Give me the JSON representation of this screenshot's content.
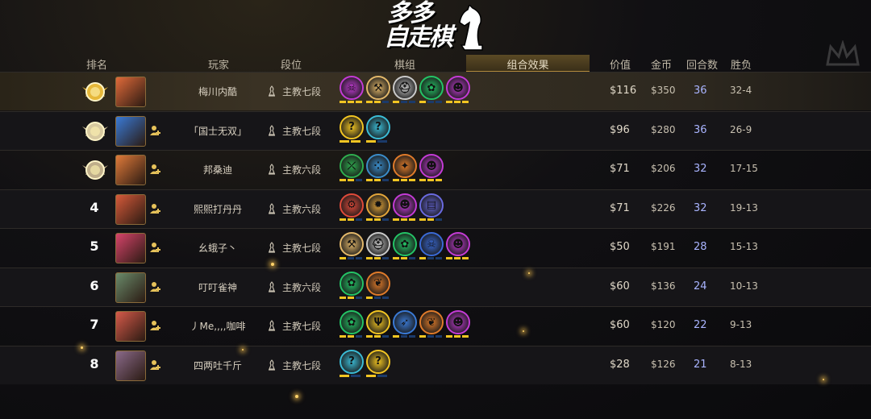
{
  "logo": {
    "line1": "多多",
    "line2": "自走棋"
  },
  "header": {
    "rank": "排名",
    "player": "玩家",
    "tier": "段位",
    "pieces": "棋组",
    "combo": "组合效果",
    "value": "价值",
    "gold": "金币",
    "rounds": "回合数",
    "record": "胜负"
  },
  "colors": {
    "gold": "#f2c522",
    "bar_empty": "#1b3a6a",
    "rounds_text": "#a9b4ff"
  },
  "players": [
    {
      "rank": "1",
      "rank_display": "gold-medal-icon",
      "name": "梅川内酷",
      "tier": "主教七段",
      "synergies": [
        {
          "icon": "demon-skull-icon",
          "color": "#c43bd6",
          "filled": 3,
          "total": 3
        },
        {
          "icon": "axe-icon",
          "color": "#e3b86a",
          "filled": 2,
          "total": 3
        },
        {
          "icon": "helmet-icon",
          "color": "#c9c9c9",
          "filled": 1,
          "total": 3
        },
        {
          "icon": "paw-icon",
          "color": "#24c466",
          "filled": 1,
          "total": 3
        },
        {
          "icon": "imp-icon",
          "color": "#c43bd6",
          "filled": 3,
          "total": 3
        }
      ],
      "value": "$116",
      "gold": "$350",
      "rounds": "36",
      "record": "32-4"
    },
    {
      "rank": "2",
      "rank_display": "silver-medal-icon",
      "name": "「国士无双」",
      "tier": "主教七段",
      "synergies": [
        {
          "icon": "question-mark-icon",
          "color": "#f2c522",
          "filled": 2,
          "total": 2
        },
        {
          "icon": "question-mark-icon",
          "color": "#3bbcd6",
          "filled": 1,
          "total": 2
        }
      ],
      "value": "$96",
      "gold": "$280",
      "rounds": "36",
      "record": "26-9"
    },
    {
      "rank": "3",
      "rank_display": "bronze-medal-icon",
      "name": "邦桑迪",
      "tier": "主教六段",
      "synergies": [
        {
          "icon": "bow-icon",
          "color": "#2fae4f",
          "filled": 2,
          "total": 3
        },
        {
          "icon": "dots-icon",
          "color": "#3a8cc9",
          "filled": 2,
          "total": 3
        },
        {
          "icon": "fox-icon",
          "color": "#e07b2a",
          "filled": 3,
          "total": 3
        },
        {
          "icon": "imp-icon",
          "color": "#c43bd6",
          "filled": 3,
          "total": 3
        }
      ],
      "value": "$71",
      "gold": "$206",
      "rounds": "32",
      "record": "17-15"
    },
    {
      "rank": "4",
      "rank_display": "4",
      "name": "熙熙打丹丹",
      "tier": "主教六段",
      "synergies": [
        {
          "icon": "mech-icon",
          "color": "#e04a3a",
          "filled": 2,
          "total": 3
        },
        {
          "icon": "gear-icon",
          "color": "#e3a53a",
          "filled": 2,
          "total": 3
        },
        {
          "icon": "imp-icon",
          "color": "#c43bd6",
          "filled": 3,
          "total": 3
        },
        {
          "icon": "book-icon",
          "color": "#6a6ae0",
          "filled": 2,
          "total": 3
        }
      ],
      "value": "$71",
      "gold": "$226",
      "rounds": "32",
      "record": "19-13"
    },
    {
      "rank": "5",
      "rank_display": "5",
      "name": "幺蛾子丶",
      "tier": "主教七段",
      "synergies": [
        {
          "icon": "axe-icon",
          "color": "#e3b86a",
          "filled": 1,
          "total": 3
        },
        {
          "icon": "helmet-icon",
          "color": "#c9c9c9",
          "filled": 2,
          "total": 3
        },
        {
          "icon": "paw-icon",
          "color": "#24c466",
          "filled": 2,
          "total": 3
        },
        {
          "icon": "demon-skull-icon",
          "color": "#3a6ad6",
          "filled": 1,
          "total": 3
        },
        {
          "icon": "imp-icon",
          "color": "#c43bd6",
          "filled": 3,
          "total": 3
        }
      ],
      "value": "$50",
      "gold": "$191",
      "rounds": "28",
      "record": "15-13"
    },
    {
      "rank": "6",
      "rank_display": "6",
      "name": "叮叮雀神",
      "tier": "主教六段",
      "synergies": [
        {
          "icon": "paw-icon",
          "color": "#24c466",
          "filled": 2,
          "total": 3
        },
        {
          "icon": "leaf-icon",
          "color": "#e07b2a",
          "filled": 1,
          "total": 3
        }
      ],
      "value": "$60",
      "gold": "$136",
      "rounds": "24",
      "record": "10-13"
    },
    {
      "rank": "7",
      "rank_display": "7",
      "name": "丿Me,,,,咖啡",
      "tier": "主教七段",
      "synergies": [
        {
          "icon": "paw-icon",
          "color": "#24c466",
          "filled": 2,
          "total": 3
        },
        {
          "icon": "trident-icon",
          "color": "#f2c522",
          "filled": 2,
          "total": 3
        },
        {
          "icon": "feather-icon",
          "color": "#3a7ad6",
          "filled": 1,
          "total": 3
        },
        {
          "icon": "leaf-icon",
          "color": "#e07b2a",
          "filled": 1,
          "total": 3
        },
        {
          "icon": "imp-icon",
          "color": "#c43bd6",
          "filled": 3,
          "total": 3
        }
      ],
      "value": "$60",
      "gold": "$120",
      "rounds": "22",
      "record": "9-13"
    },
    {
      "rank": "8",
      "rank_display": "8",
      "name": "四两吐千斤",
      "tier": "主教七段",
      "synergies": [
        {
          "icon": "question-mark-icon",
          "color": "#3bbcd6",
          "filled": 1,
          "total": 2
        },
        {
          "icon": "question-mark-icon",
          "color": "#f2c522",
          "filled": 1,
          "total": 2
        }
      ],
      "value": "$28",
      "gold": "$126",
      "rounds": "21",
      "record": "8-13"
    }
  ]
}
